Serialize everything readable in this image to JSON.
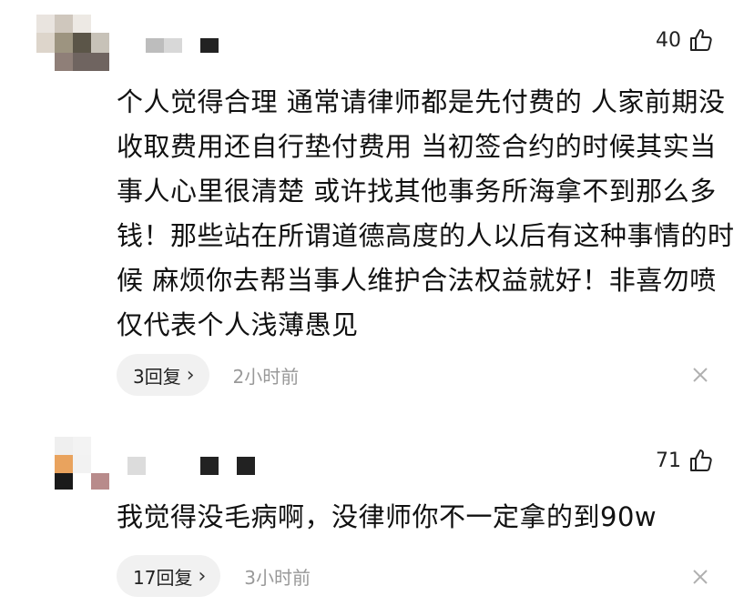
{
  "comments": [
    {
      "likes": "40",
      "text": "个人觉得合理 通常请律师都是先付费的 人家前期没收取费用还自行垫付费用 当初签合约的时候其实当事人心里很清楚 或许找其他事务所海拿不到那么多钱！那些站在所谓道德高度的人以后有这种事情的时候 麻烦你去帮当事人维护合法权益就好！非喜勿喷 仅代表个人浅薄愚见",
      "reply_label": "3回复",
      "time": "2小时前"
    },
    {
      "likes": "71",
      "text": "我觉得没毛病啊，没律师你不一定拿的到90w",
      "reply_label": "17回复",
      "time": "3小时前"
    }
  ],
  "icons": {
    "like": "thumbs-up-icon",
    "reply_arrow": "chevron-right-icon",
    "dismiss": "close-icon"
  },
  "colors": {
    "text": "#111111",
    "muted": "#999999",
    "pill_bg": "#f1f1f1"
  }
}
